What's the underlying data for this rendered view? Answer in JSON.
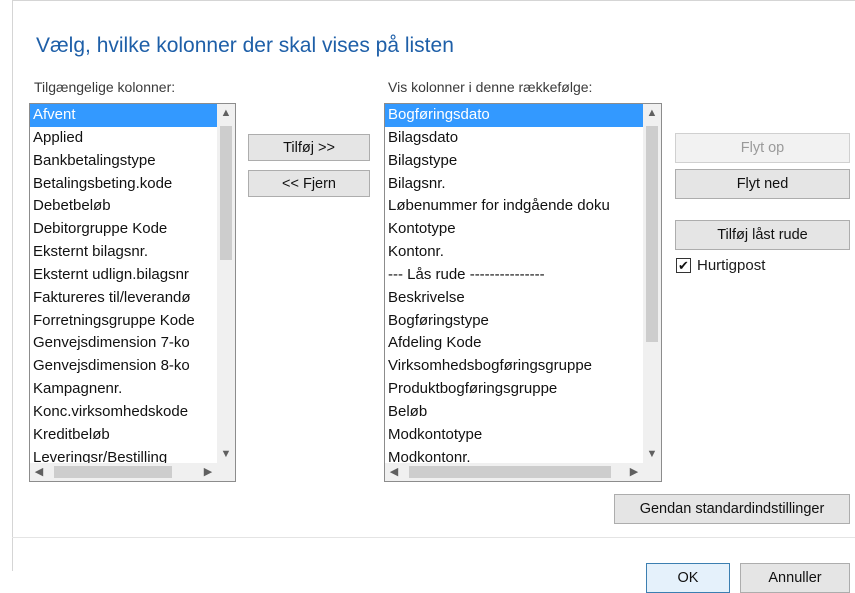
{
  "dialog": {
    "title": "Vælg, hvilke kolonner der skal vises på listen"
  },
  "available": {
    "caption": "Tilgængelige kolonner:",
    "items": [
      "Afvent",
      "Applied",
      "Bankbetalingstype",
      "Betalingsbeting.kode",
      "Debetbeløb",
      "Debitorgruppe Kode",
      "Eksternt bilagsnr.",
      "Eksternt udlign.bilagsnr",
      "Faktureres til/leverandø",
      "Forretningsgruppe Kode",
      "Genvejsdimension 7-ko",
      "Genvejsdimension 8-ko",
      "Kampagnenr.",
      "Konc.virksomhedskode",
      "Kreditbeløb",
      "Leveringsr/Bestilling"
    ],
    "selected_index": 0
  },
  "shown": {
    "caption": "Vis kolonner i denne rækkefølge:",
    "items": [
      "Bogføringsdato",
      "Bilagsdato",
      "Bilagstype",
      "Bilagsnr.",
      "Løbenummer for indgående doku",
      "Kontotype",
      "Kontonr.",
      "--- Lås rude ---------------",
      "Beskrivelse",
      "Bogføringstype",
      "Afdeling Kode",
      "Virksomhedsbogføringsgruppe",
      "Produktbogføringsgruppe",
      "Beløb",
      "Modkontotype",
      "Modkontonr."
    ],
    "selected_index": 0
  },
  "buttons": {
    "add": "Tilføj >>",
    "remove": "<< Fjern",
    "move_up": "Flyt op",
    "move_down": "Flyt ned",
    "add_locked_pane": "Tilføj låst rude",
    "restore_defaults": "Gendan standardindstillinger",
    "ok": "OK",
    "cancel": "Annuller"
  },
  "options": {
    "quick_entry_label": "Hurtigpost",
    "quick_entry_checked": true
  },
  "icons": {
    "up": "▲",
    "down": "▼",
    "left": "◀",
    "right": "▶",
    "check": "✔"
  },
  "colors": {
    "title": "#1e5fa8",
    "selection": "#3399ff"
  }
}
